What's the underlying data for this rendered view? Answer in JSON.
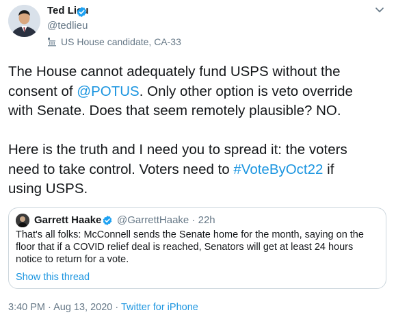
{
  "tweet": {
    "author_name": "Ted Lieu",
    "author_handle": "@tedlieu",
    "account_label": "US House candidate, CA-33",
    "text_lines": [
      [
        "The House cannot adequately fund USPS without the"
      ],
      [
        "consent of ",
        "@POTUS",
        ". Only other option is veto override"
      ],
      [
        "with Senate. Does that seem remotely plausible? NO."
      ],
      [
        "Here is the truth and I need you to spread it: the voters"
      ],
      [
        "need to take control. Voters need to ",
        "#VoteByOct22",
        " if"
      ],
      [
        "using USPS."
      ]
    ],
    "mention": "@POTUS",
    "hashtag": "#VoteByOct22"
  },
  "quoted_tweet": {
    "author_name": "Garrett Haake",
    "author_handle": "@GarrettHaake",
    "separator": " · ",
    "time_ago": "22h",
    "text_lines": [
      "That's all folks: McConnell sends the Senate home for the month, saying on the",
      "floor that if a COVID relief deal is reached, Senators will get at least 24 hours",
      "notice to return for a vote."
    ],
    "show_thread": "Show this thread"
  },
  "footer": {
    "time": "3:40 PM",
    "separator": " · ",
    "date": "Aug 13, 2020",
    "source": "Twitter for iPhone"
  },
  "colors": {
    "link": "#1b95e0",
    "verified": "#1da1f2",
    "muted": "#657786",
    "border": "#ccd6dd"
  },
  "icons": {
    "verified": "verified-badge-icon",
    "label": "government-building-icon",
    "menu": "chevron-down-icon"
  }
}
